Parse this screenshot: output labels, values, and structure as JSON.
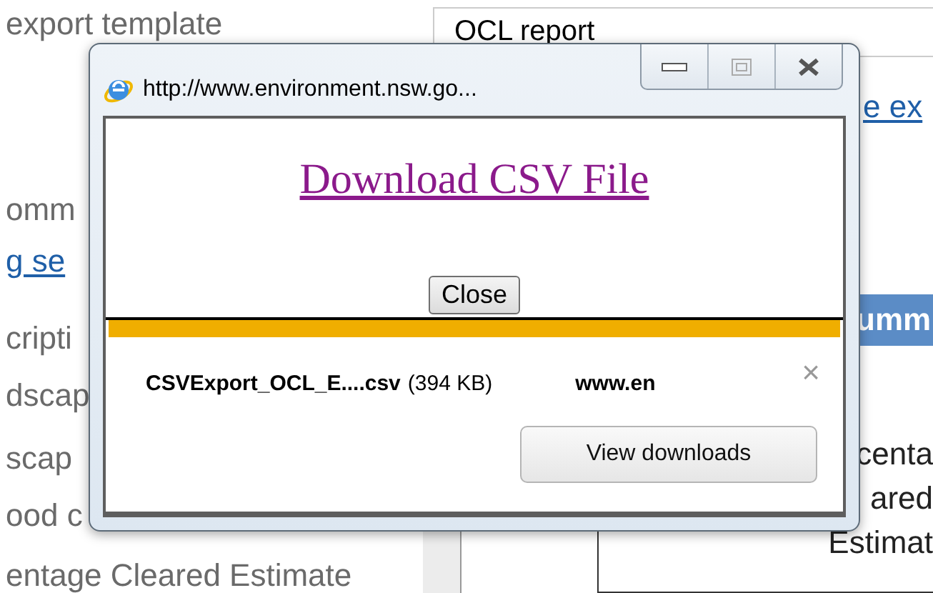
{
  "page": {
    "labels": [
      {
        "kind": "text",
        "text": "export template"
      },
      {
        "kind": "text",
        "text": "omm"
      },
      {
        "kind": "link",
        "text": "g se"
      },
      {
        "kind": "text",
        "text": "cripti"
      },
      {
        "kind": "text",
        "text": "dscap"
      },
      {
        "kind": "text",
        "text": "scap"
      },
      {
        "kind": "text",
        "text": "ood c"
      },
      {
        "kind": "text",
        "text": "entage Cleared Estimate"
      }
    ],
    "report_name": {
      "value": "OCL report"
    },
    "link": "e ex",
    "section_header": "umm",
    "column_texts": [
      "centa",
      "ared",
      "Estimat"
    ]
  },
  "popup": {
    "title": "http://www.environment.nsw.go...",
    "link": "Download CSV File",
    "close_button": "Close",
    "download": {
      "file_name": "CSVExport_OCL_E....csv",
      "size": "(394 KB)",
      "source": "www.en",
      "dismiss": "×",
      "button": "View downloads"
    }
  }
}
